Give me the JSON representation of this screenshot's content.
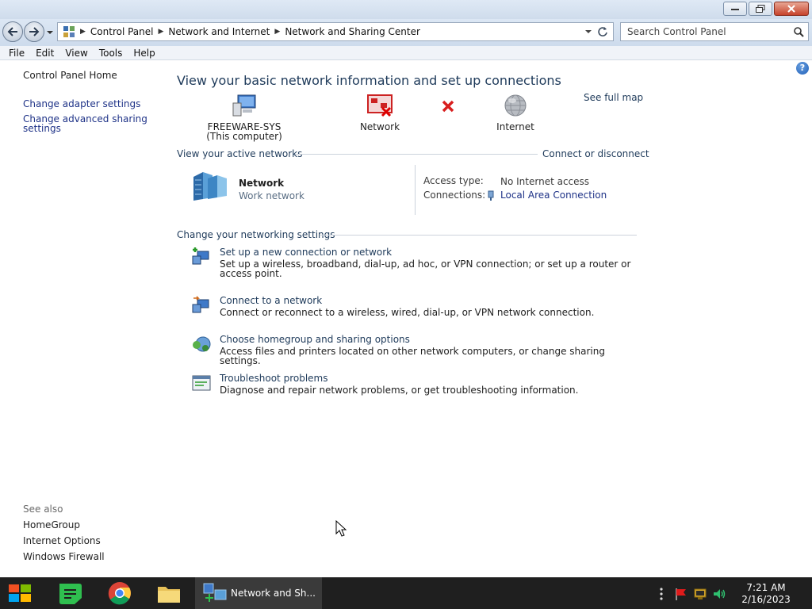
{
  "window": {
    "buttons": {
      "minimize": "minimize-icon",
      "restore": "restore-icon",
      "close": "close-icon"
    }
  },
  "address": {
    "crumbs": [
      "Control Panel",
      "Network and Internet",
      "Network and Sharing Center"
    ]
  },
  "search": {
    "placeholder": "Search Control Panel"
  },
  "menu": [
    "File",
    "Edit",
    "View",
    "Tools",
    "Help"
  ],
  "left_pane": {
    "home": "Control Panel Home",
    "links": [
      "Change adapter settings",
      "Change advanced sharing settings"
    ],
    "see_also_label": "See also",
    "see_also": [
      "HomeGroup",
      "Internet Options",
      "Windows Firewall"
    ]
  },
  "main": {
    "heading": "View your basic network information and set up connections",
    "see_full_map": "See full map",
    "map": {
      "computer_name": "FREEWARE-SYS",
      "computer_sub": "(This computer)",
      "network": "Network",
      "internet": "Internet"
    },
    "active_networks": {
      "label": "View your active networks",
      "connect_link": "Connect or disconnect",
      "network_name": "Network",
      "network_type": "Work network",
      "access_type_label": "Access type:",
      "access_type_value": "No Internet access",
      "connections_label": "Connections:",
      "connections_value": "Local Area Connection"
    },
    "change_settings": {
      "label": "Change your networking settings",
      "tasks": [
        {
          "title": "Set up a new connection or network",
          "desc": "Set up a wireless, broadband, dial-up, ad hoc, or VPN connection; or set up a router or access point."
        },
        {
          "title": "Connect to a network",
          "desc": "Connect or reconnect to a wireless, wired, dial-up, or VPN network connection."
        },
        {
          "title": "Choose homegroup and sharing options",
          "desc": "Access files and printers located on other network computers, or change sharing settings."
        },
        {
          "title": "Troubleshoot problems",
          "desc": "Diagnose and repair network problems, or get troubleshooting information."
        }
      ]
    }
  },
  "taskbar": {
    "active_window": "Network and Sh...",
    "time": "7:21 AM",
    "date": "2/16/2023"
  },
  "colors": {
    "link": "#1e3287",
    "heading": "#1e3a5a",
    "taskbar": "#1f1f1f"
  }
}
